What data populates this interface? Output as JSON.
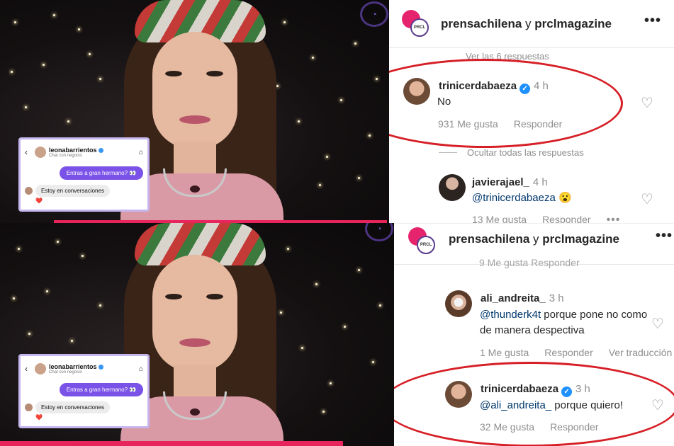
{
  "colors": {
    "verified_blue": "#1e90ff",
    "highlight_red": "#d61f26",
    "chat_purple": "#7b52e8",
    "brand_pink": "#e6246e"
  },
  "top": {
    "chat_card": {
      "username": "leonabarrientos",
      "subtitle": "Chat con negocio",
      "outgoing": "Entras a gran hermano? 👀",
      "incoming": "Estoy en conversaciones",
      "reaction": "❤️"
    },
    "header": {
      "account1": "prensachilena",
      "connector": " y ",
      "account2": "prclmagazine",
      "more": "•••"
    },
    "view_replies": "Ver las 6 respuestas",
    "comment1": {
      "username": "trinicerdabaeza",
      "time": "4 h",
      "text": "No",
      "likes": "931 Me gusta",
      "reply": "Responder"
    },
    "hide_replies": "Ocultar todas las respuestas",
    "comment2": {
      "username": "javierajael_",
      "time": "4 h",
      "mention": "@trinicerdabaeza",
      "emoji": "😮",
      "likes": "13 Me gusta",
      "reply": "Responder",
      "more": "•••"
    }
  },
  "bottom": {
    "chat_card": {
      "username": "leonabarrientos",
      "subtitle": "Chat con negocio",
      "outgoing": "Entras a gran hermano? 👀",
      "incoming": "Estoy en conversaciones",
      "reaction": "❤️"
    },
    "header": {
      "account1": "prensachilena",
      "connector": " y ",
      "account2": "prclmagazine",
      "more": "•••"
    },
    "prev_meta": "9 Me gusta   Responder",
    "comment1": {
      "username": "ali_andreita_",
      "time": "3 h",
      "mention": "@thunderk4t",
      "text": " porque pone no como de manera despectiva",
      "likes": "1 Me gusta",
      "reply": "Responder",
      "translate": "Ver traducción"
    },
    "comment2": {
      "username": "trinicerdabaeza",
      "time": "3 h",
      "mention": "@ali_andreita_",
      "text": " porque quiero!",
      "likes": "32 Me gusta",
      "reply": "Responder"
    }
  }
}
